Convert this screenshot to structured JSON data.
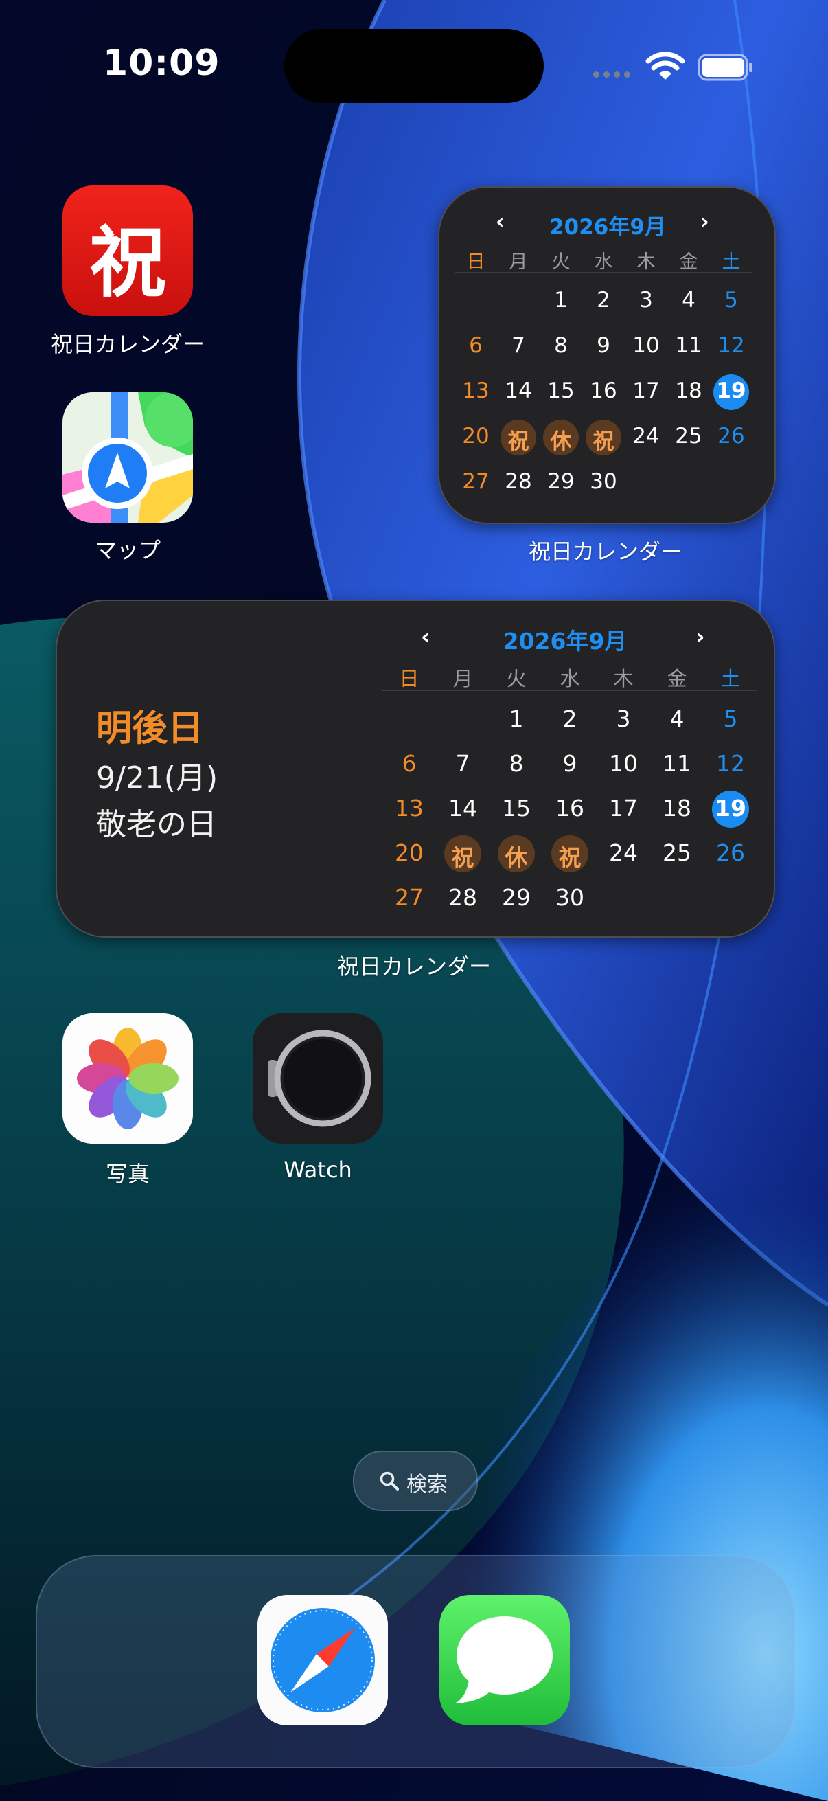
{
  "status_bar": {
    "time": "10:09"
  },
  "apps": {
    "holiday_calendar": {
      "label": "祝日カレンダー",
      "glyph": "祝"
    },
    "maps": {
      "label": "マップ"
    },
    "photos": {
      "label": "写真"
    },
    "watch": {
      "label": "Watch"
    }
  },
  "calendar": {
    "month_title": "2026年9月",
    "weekdays": [
      "日",
      "月",
      "火",
      "水",
      "木",
      "金",
      "土"
    ],
    "weeks": [
      [
        "",
        "",
        "1",
        "2",
        "3",
        "4",
        "5"
      ],
      [
        "6",
        "7",
        "8",
        "9",
        "10",
        "11",
        "12"
      ],
      [
        "13",
        "14",
        "15",
        "16",
        "17",
        "18",
        "19"
      ],
      [
        "20",
        "祝",
        "休",
        "祝",
        "24",
        "25",
        "26"
      ],
      [
        "27",
        "28",
        "29",
        "30",
        "",
        "",
        ""
      ]
    ],
    "today": "19"
  },
  "widgets": {
    "small": {
      "label": "祝日カレンダー"
    },
    "medium": {
      "label": "祝日カレンダー",
      "next_holiday_title": "明後日",
      "next_holiday_date": "9/21(月)",
      "next_holiday_name": "敬老の日"
    }
  },
  "search": {
    "label": "検索",
    "icon": "search-icon"
  },
  "dock": {
    "apps": [
      "Safari",
      "メッセージ"
    ]
  },
  "colors": {
    "accent_blue": "#1f8ef1",
    "sunday_orange": "#f28c28",
    "holiday_red": "#e81e16",
    "widget_bg": "#232325"
  }
}
